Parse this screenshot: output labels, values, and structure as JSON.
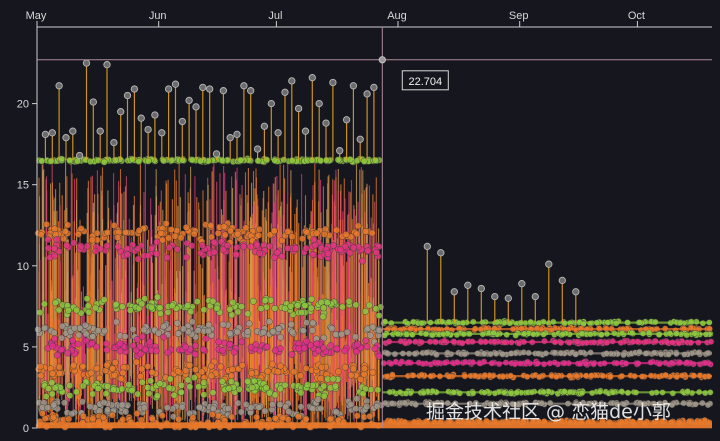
{
  "chart_data": {
    "type": "scatter",
    "title": "",
    "xlabel": "",
    "ylabel": "",
    "x_ticks": [
      "May",
      "Jun",
      "Jul",
      "Aug",
      "Sep",
      "Oct"
    ],
    "x_range": [
      "2020-05-01",
      "2020-10-20"
    ],
    "y_ticks": [
      0,
      5,
      10,
      15,
      20
    ],
    "ylim": [
      0,
      23.8
    ],
    "grid": false,
    "legend": "none",
    "crosshair": {
      "x": "2020-07-28",
      "y": 22.704,
      "label": "22.704"
    },
    "regime_change": "2020-07-28",
    "series": [
      {
        "color": "#8dc63f",
        "level_before": 16.5,
        "level_after": 6.5
      },
      {
        "color": "#e8792b",
        "level_before": 12.0,
        "level_after": 6.1
      },
      {
        "color": "#e2357f",
        "level_before": 11.0,
        "level_after": 5.3
      },
      {
        "color": "#8dc63f",
        "level_before": 7.5,
        "level_after": 5.8
      },
      {
        "color": "#a0978a",
        "level_before": 6.0,
        "level_after": 4.6
      },
      {
        "color": "#e0308a",
        "level_before": 5.0,
        "level_after": 4.0
      },
      {
        "color": "#e8792b",
        "level_before": 3.5,
        "level_after": 3.2
      },
      {
        "color": "#8dc63f",
        "level_before": 2.5,
        "level_after": 2.2
      },
      {
        "color": "#a0978a",
        "level_before": 1.3,
        "level_after": 1.5
      },
      {
        "color": "#e8792b",
        "level_before": 0.4,
        "level_after": 0.4
      }
    ],
    "spikes_before": [
      18.1,
      18.2,
      21.1,
      17.9,
      18.3,
      16.8,
      22.5,
      20.1,
      18.3,
      22.4,
      17.6,
      19.5,
      20.5,
      20.9,
      19.1,
      18.4,
      19.3,
      18.2,
      20.9,
      21.2,
      18.9,
      20.2,
      19.8,
      21.0,
      20.9,
      16.9,
      20.8,
      17.9,
      18.1,
      21.1,
      20.8,
      17.2,
      18.6,
      20.0,
      18.2,
      20.7,
      21.4,
      19.7,
      18.3,
      21.6,
      20.0,
      18.8,
      21.3,
      17.1,
      19.0,
      21.1,
      17.8,
      20.6,
      21.0
    ],
    "spikes_after": [
      11.2,
      10.8,
      8.4,
      8.8,
      8.6,
      8.1,
      8.0,
      8.9,
      8.1,
      10.1,
      9.1,
      8.4
    ],
    "colors": {
      "background": "#16161e",
      "axis": "#d8d8d8",
      "crosshair": "#b08a9a"
    },
    "watermark": "掘金技术社区 @ 恋猫de小郭"
  }
}
